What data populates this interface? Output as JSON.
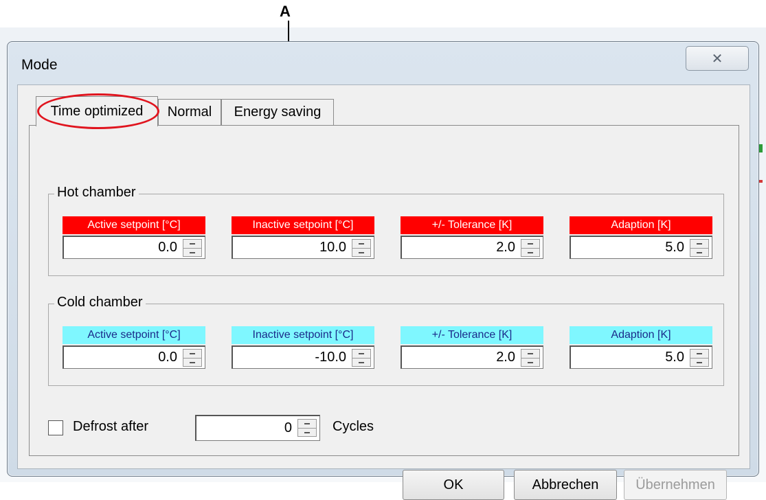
{
  "annotation": {
    "label": "A"
  },
  "dialog": {
    "title": "Mode",
    "close_symbol": "✕",
    "tabs": [
      {
        "label": "Time optimized",
        "active": true
      },
      {
        "label": "Normal",
        "active": false
      },
      {
        "label": "Energy saving",
        "active": false
      }
    ],
    "hot_chamber": {
      "label": "Hot chamber",
      "color": "#ff0000",
      "fields": [
        {
          "label": "Active setpoint [°C]",
          "value": "0.0"
        },
        {
          "label": "Inactive setpoint [°C]",
          "value": "10.0"
        },
        {
          "label": "+/- Tolerance [K]",
          "value": "2.0"
        },
        {
          "label": "Adaption [K]",
          "value": "5.0"
        }
      ]
    },
    "cold_chamber": {
      "label": "Cold chamber",
      "color": "#7ff7ff",
      "fields": [
        {
          "label": "Active setpoint [°C]",
          "value": "0.0"
        },
        {
          "label": "Inactive setpoint [°C]",
          "value": "-10.0"
        },
        {
          "label": "+/- Tolerance [K]",
          "value": "2.0"
        },
        {
          "label": "Adaption [K]",
          "value": "5.0"
        }
      ]
    },
    "defrost": {
      "label": "Defrost after",
      "value": "0",
      "unit": "Cycles",
      "checked": false
    },
    "buttons": {
      "ok": "OK",
      "cancel": "Abbrechen",
      "apply": "Übernehmen"
    }
  }
}
